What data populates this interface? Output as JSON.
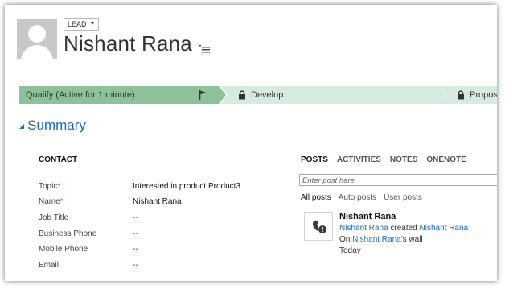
{
  "header": {
    "entity_type": "LEAD",
    "record_name": "Nishant Rana"
  },
  "process": {
    "stages": [
      {
        "label": "Qualify (Active for 1 minute)",
        "state": "active"
      },
      {
        "label": "Develop",
        "state": "locked"
      },
      {
        "label": "Propose",
        "state": "locked"
      }
    ]
  },
  "summary": {
    "title": "Summary",
    "section": "CONTACT",
    "fields": [
      {
        "label": "Topic",
        "required": "*",
        "value": "Interested in product Product3"
      },
      {
        "label": "Name",
        "required": "*",
        "value": "Nishant Rana"
      },
      {
        "label": "Job Title",
        "required": "",
        "value": "--"
      },
      {
        "label": "Business Phone",
        "required": "",
        "value": "--"
      },
      {
        "label": "Mobile Phone",
        "required": "",
        "value": "--"
      },
      {
        "label": "Email",
        "required": "",
        "value": "--"
      }
    ]
  },
  "social": {
    "tabs": [
      "POSTS",
      "ACTIVITIES",
      "NOTES",
      "ONENOTE"
    ],
    "post_placeholder": "Enter post here",
    "filters": [
      "All posts",
      "Auto posts",
      "User posts"
    ],
    "post": {
      "author": "Nishant Rana",
      "actor": "Nishant Rana",
      "verb": " created ",
      "target": "Nishant Rana",
      "wall_prefix": "On ",
      "wall_owner": "Nishant Rana",
      "wall_suffix": "'s wall",
      "time": "Today"
    }
  },
  "colors": {
    "active_stage": "#8dc199",
    "inactive_stage": "#d6ebdd",
    "link": "#1d6bb5",
    "required": "#e02020"
  }
}
